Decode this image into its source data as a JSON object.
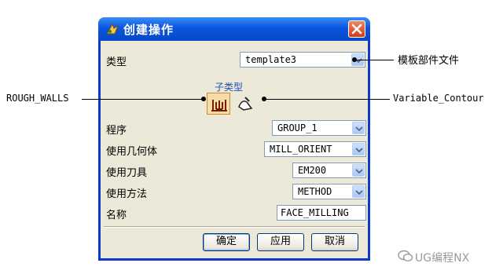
{
  "dialog": {
    "title": "创建操作",
    "icons": {
      "app": "ug-app-icon",
      "close": "close-icon"
    },
    "type": {
      "label": "类型",
      "value": "template3"
    },
    "subtype": {
      "caption": "子类型",
      "options": [
        {
          "icon": "rough-walls-icon",
          "selected": true
        },
        {
          "icon": "variable-contour-icon",
          "selected": false
        }
      ]
    },
    "program": {
      "label": "程序",
      "value": "GROUP_1"
    },
    "geometry": {
      "label": "使用几何体",
      "value": "MILL_ORIENT"
    },
    "tool": {
      "label": "使用刀具",
      "value": "EM200"
    },
    "method": {
      "label": "使用方法",
      "value": "METHOD"
    },
    "name": {
      "label": "名称",
      "value": "FACE_MILLING"
    },
    "buttons": {
      "ok": "确定",
      "apply": "应用",
      "cancel": "取消"
    }
  },
  "annotations": {
    "template_file": "模板部件文件",
    "rough_walls": "ROUGH_WALLS",
    "variable_contour": "Variable_Contour"
  },
  "watermark": "UG编程NX",
  "colors": {
    "titlebar": "#0a56e0",
    "dialog_bg": "#ece9d8",
    "field_border": "#7f9db9"
  }
}
